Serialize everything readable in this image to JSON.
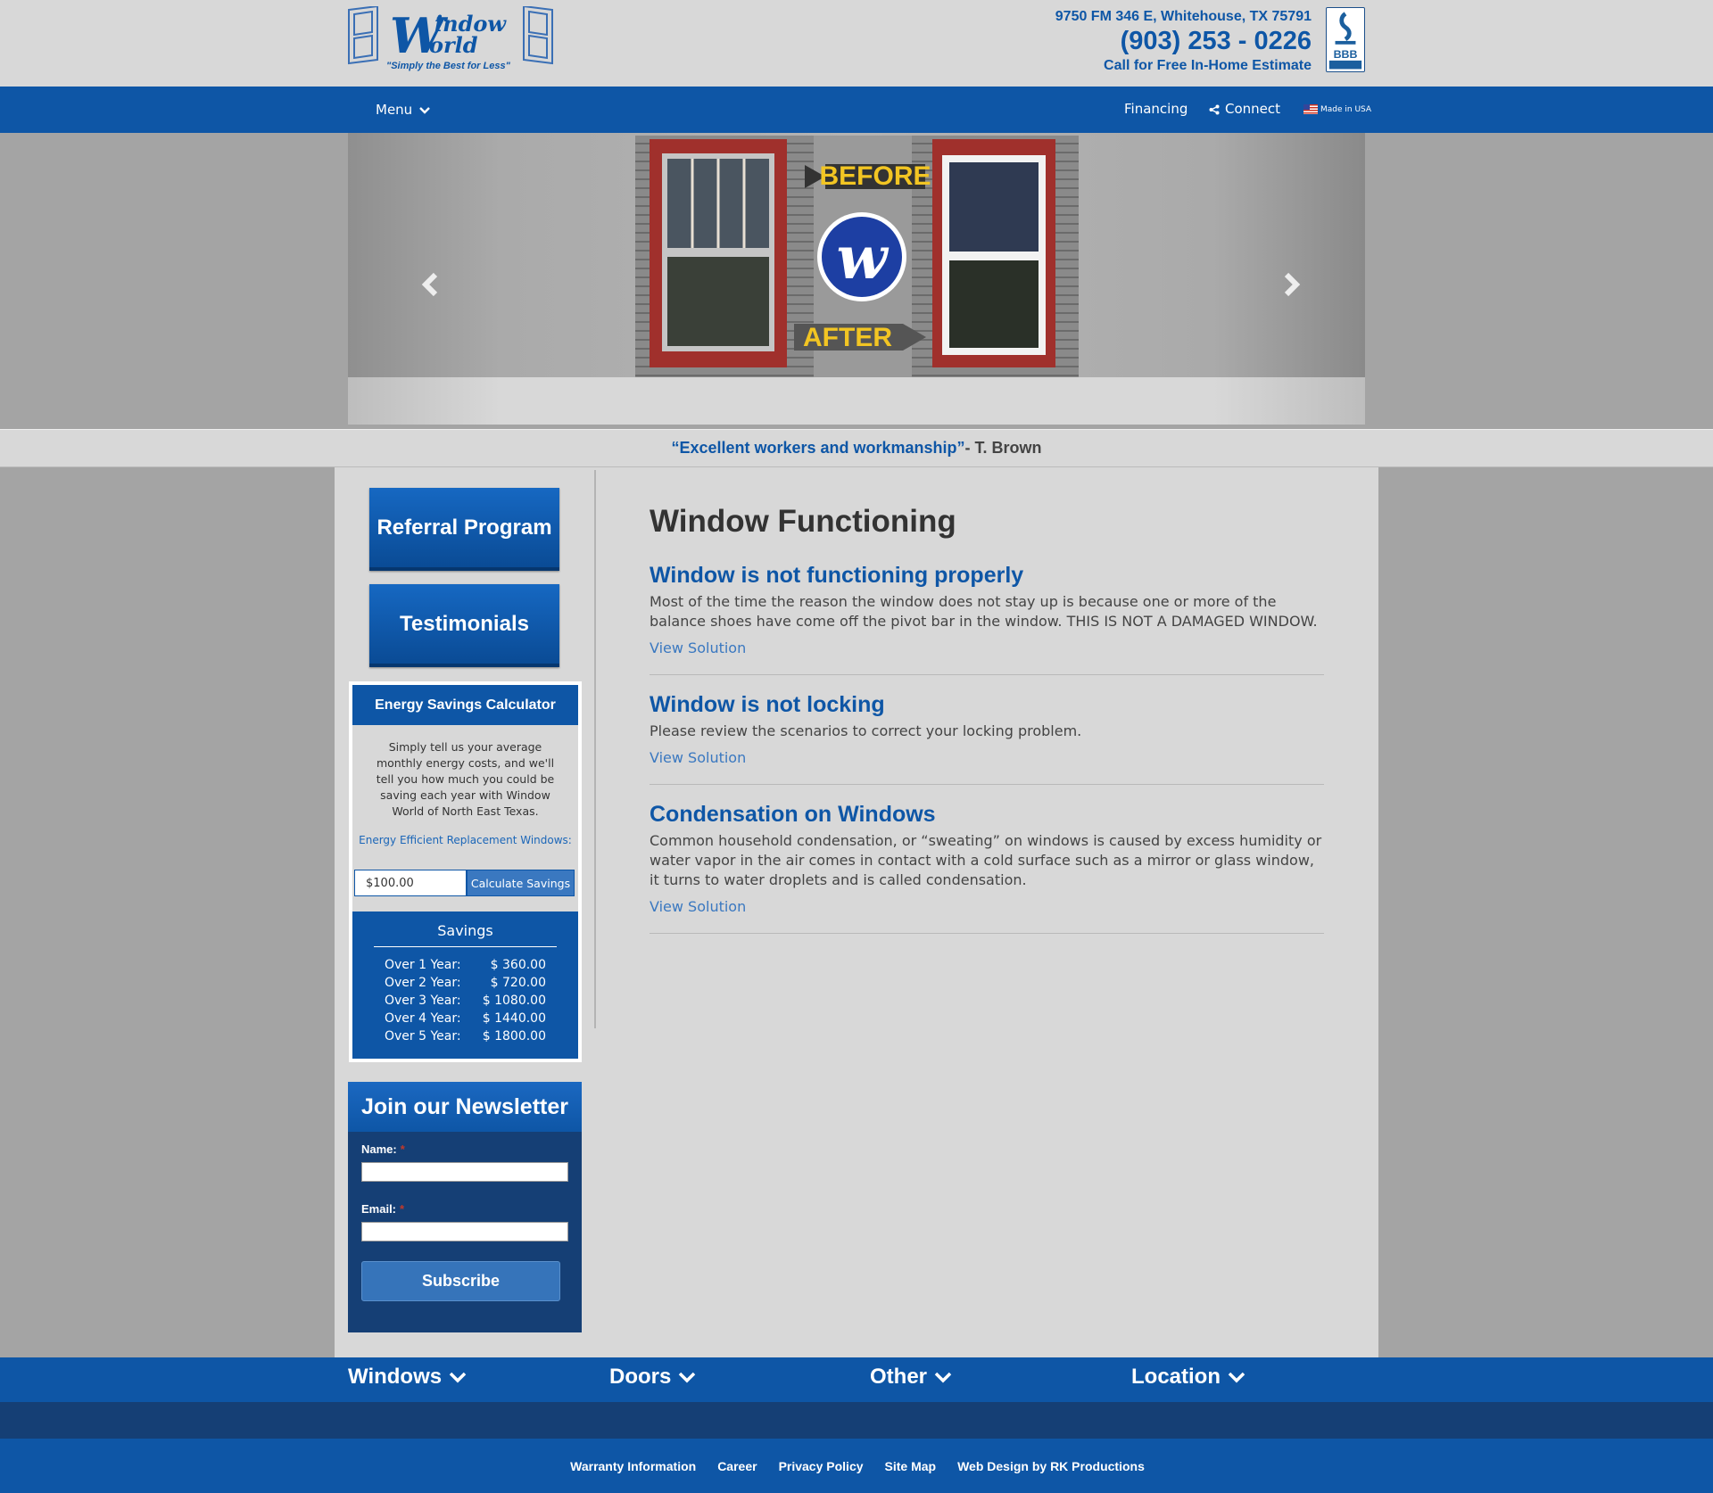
{
  "header": {
    "address": "9750 FM 346 E, Whitehouse, TX 75791",
    "phone": "(903) 253 - 0226",
    "cta": "Call for Free In-Home Estimate",
    "logo_name": "Window World",
    "logo_tagline": "\"Simply the Best for Less\"",
    "bbb_text": "BBB"
  },
  "nav": {
    "menu": "Menu",
    "financing": "Financing",
    "connect": "Connect",
    "made_in_usa": "Made in USA"
  },
  "slider": {
    "before": "BEFORE",
    "after": "AFTER"
  },
  "testimonial": {
    "quote": "“Excellent workers and workmanship”",
    "author": "- T. Brown"
  },
  "sidebar": {
    "referral": "Referral Program",
    "testimonials": "Testimonials",
    "calculator": {
      "title": "Energy Savings Calculator",
      "description": "Simply tell us your average monthly energy costs, and we'll tell you how much you could be saving each year with Window World of North East Texas.",
      "label": "Energy Efficient Replacement Windows:",
      "input_value": "$100.00",
      "button": "Calculate Savings",
      "savings_title": "Savings",
      "rows": [
        {
          "label": "Over 1 Year:",
          "value": "$ 360.00"
        },
        {
          "label": "Over 2 Year:",
          "value": "$ 720.00"
        },
        {
          "label": "Over 3 Year:",
          "value": "$ 1080.00"
        },
        {
          "label": "Over 4 Year:",
          "value": "$ 1440.00"
        },
        {
          "label": "Over 5 Year:",
          "value": "$ 1800.00"
        }
      ]
    },
    "newsletter": {
      "title": "Join our Newsletter",
      "name_label": "Name:",
      "email_label": "Email:",
      "required": "*",
      "button": "Subscribe"
    }
  },
  "main": {
    "title": "Window Functioning",
    "items": [
      {
        "heading": "Window is not functioning properly",
        "body": "Most of the time the reason the window does not stay up is because one or more of the balance shoes have come off the pivot bar in the window. THIS IS NOT A DAMAGED WINDOW.",
        "link": "View Solution"
      },
      {
        "heading": "Window is not locking",
        "body": "Please review the scenarios to correct your locking problem.",
        "link": "View Solution"
      },
      {
        "heading": "Condensation on Windows",
        "body": "Common household condensation, or “sweating” on windows is caused by excess humidity or water vapor in the air comes in contact with a cold surface such as a mirror or glass window, it turns to water droplets and is called condensation.",
        "link": "View Solution"
      }
    ]
  },
  "footer": {
    "nav": [
      "Windows",
      "Doors",
      "Other",
      "Location"
    ],
    "links": [
      "Warranty Information",
      "Career",
      "Privacy Policy",
      "Site Map",
      "Web Design by RK Productions"
    ]
  },
  "colors": {
    "brand_blue": "#0e56a6",
    "dark_blue": "#153f75",
    "page_gray": "#d8d8d8"
  }
}
